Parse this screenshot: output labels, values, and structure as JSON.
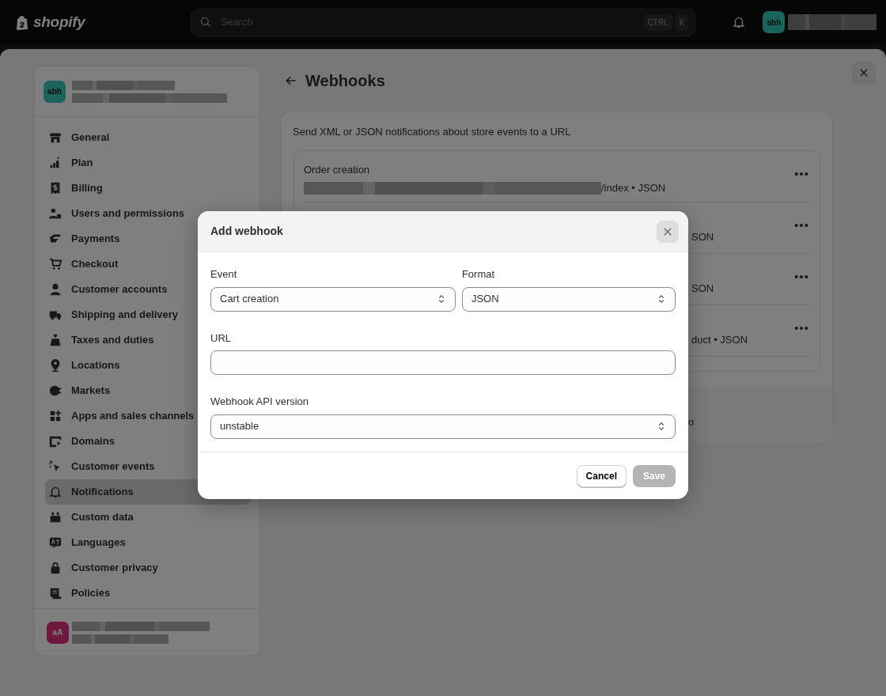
{
  "top_bar": {
    "logo": "shopify",
    "search": {
      "placeholder": "Search",
      "shortcut": [
        "CTRL",
        "K"
      ]
    },
    "account": {
      "initials": "abh"
    }
  },
  "sidebar": {
    "store": {
      "initials": "abh"
    },
    "items": [
      {
        "label": "General",
        "selected": false
      },
      {
        "label": "Plan",
        "selected": false
      },
      {
        "label": "Billing",
        "selected": false
      },
      {
        "label": "Users and permissions",
        "selected": false
      },
      {
        "label": "Payments",
        "selected": false
      },
      {
        "label": "Checkout",
        "selected": false
      },
      {
        "label": "Customer accounts",
        "selected": false
      },
      {
        "label": "Shipping and delivery",
        "selected": false
      },
      {
        "label": "Taxes and duties",
        "selected": false
      },
      {
        "label": "Locations",
        "selected": false
      },
      {
        "label": "Markets",
        "selected": false
      },
      {
        "label": "Apps and sales channels",
        "selected": false
      },
      {
        "label": "Domains",
        "selected": false
      },
      {
        "label": "Customer events",
        "selected": false
      },
      {
        "label": "Notifications",
        "selected": true
      },
      {
        "label": "Custom data",
        "selected": false
      },
      {
        "label": "Languages",
        "selected": false
      },
      {
        "label": "Customer privacy",
        "selected": false
      },
      {
        "label": "Policies",
        "selected": false
      }
    ],
    "footer_account": {
      "initials": "aA"
    }
  },
  "page": {
    "title": "Webhooks",
    "description": "Send XML or JSON notifications about store events to a URL",
    "webhooks": [
      {
        "kind": "full",
        "title": "Order creation",
        "detail": "/index • JSON"
      },
      {
        "kind": "covered",
        "detail": "SON"
      },
      {
        "kind": "covered",
        "detail": "SON"
      },
      {
        "kind": "covered",
        "detail": "duct • JSON"
      }
    ],
    "footer_fragment": "o"
  },
  "modal": {
    "title": "Add webhook",
    "rows": [
      [
        {
          "kind": "select",
          "label": "Event",
          "value": "Cart creation"
        },
        {
          "kind": "select",
          "label": "Format",
          "value": "JSON"
        }
      ],
      [
        {
          "kind": "text",
          "label": "URL"
        }
      ],
      [
        {
          "kind": "select",
          "label": "Webhook API version",
          "value": "unstable"
        }
      ]
    ],
    "buttons": [
      {
        "label": "Cancel",
        "disabled": false
      },
      {
        "label": "Save",
        "disabled": true
      }
    ]
  }
}
